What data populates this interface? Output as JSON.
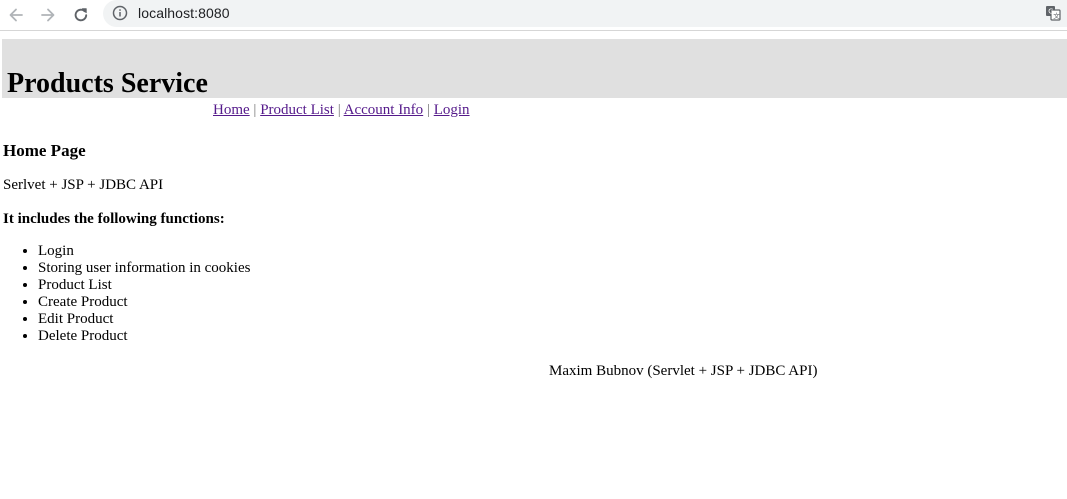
{
  "browser": {
    "url": "localhost:8080"
  },
  "header": {
    "title": "Products Service"
  },
  "menu": {
    "items": [
      {
        "label": "Home"
      },
      {
        "label": "Product List"
      },
      {
        "label": "Account Info"
      },
      {
        "label": "Login"
      }
    ],
    "separator": " | "
  },
  "main": {
    "heading": "Home Page",
    "subtitle": "Serlvet + JSP + JDBC API",
    "functions_heading": "It includes the following functions:",
    "functions": [
      "Login",
      "Storing user information in cookies",
      "Product List",
      "Create Product",
      "Edit Product",
      "Delete Product"
    ]
  },
  "footer": {
    "text": "Maxim Bubnov (Servlet + JSP + JDBC API)"
  },
  "colors": {
    "header_bg": "#e0e0e0",
    "link": "#551a8b",
    "separator": "#777777"
  }
}
